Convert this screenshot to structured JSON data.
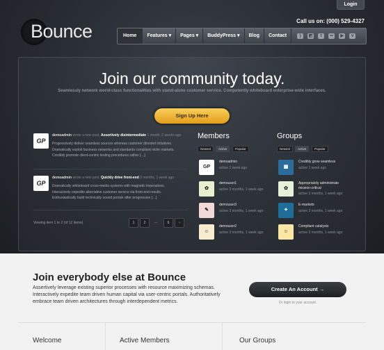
{
  "header": {
    "login_label": "Login",
    "phone": "Call us on: (000) 529-4327",
    "logo": "Bounce",
    "nav": [
      {
        "label": "Home"
      },
      {
        "label": "Features ▾"
      },
      {
        "label": "Pages ▾"
      },
      {
        "label": "BuddyPress ▾"
      },
      {
        "label": "Blog"
      },
      {
        "label": "Contact"
      }
    ],
    "social_icons": [
      "rss-icon",
      "delicious-icon",
      "twitter-icon",
      "flickr-icon",
      "youtube-icon",
      "vimeo-icon"
    ]
  },
  "hero": {
    "title": "Join our community today.",
    "subtitle": "Seamlessly network world-class functionalities with stand-alone customer service. Competently whiteboard enterprise-wide interfaces.",
    "signup_label": "Sign Up Here"
  },
  "activity": {
    "items": [
      {
        "avatar": "GP",
        "user": "demoadmin",
        "action": "wrote a new post,",
        "link": "Assertively disintermediate",
        "time": "1 month, 2 weeks ago",
        "lines": [
          "Progressively deliver seamless sources whereas customer directed initiatives.",
          "Dramatically exploit business networks and standards compliant niche markets.",
          "Credibly promote client-centric testing procedures rather […]"
        ]
      },
      {
        "avatar": "GP",
        "user": "demoadmin",
        "action": "wrote a new post,",
        "link": "Quickly drive front-end",
        "time": "3 months, 1 week ago",
        "lines": [
          "Dramatically whiteboard cross-media systems with magnetic imperatives.",
          "Interactively expedite alternative customer service via front-end results.",
          "Enthusiastically build technically sound portals after progressive […]"
        ]
      }
    ],
    "viewing": "Viewing item 1 to 2 (of 12 items)",
    "pages": [
      "1",
      "2",
      "…",
      "6",
      "›"
    ]
  },
  "members": {
    "title": "Members",
    "tabs": [
      "Newest",
      "Active",
      "Popular"
    ],
    "items": [
      {
        "name": "demoadmin",
        "time": "active 1 week ago",
        "avatar": "GP"
      },
      {
        "name": "demouser1",
        "time": "active 3 months, 1 week ago",
        "avatar": "✿"
      },
      {
        "name": "demouser3",
        "time": "active 3 months, 1 week ago",
        "avatar": "✎"
      },
      {
        "name": "demouser2",
        "time": "active 3 months, 1 week ago",
        "avatar": "☺"
      }
    ]
  },
  "groups": {
    "title": "Groups",
    "tabs": [
      "Newest",
      "Active",
      "Popular"
    ],
    "items": [
      {
        "name": "Credibly grow seamless",
        "time": "active 1 week ago",
        "avatar": "▦"
      },
      {
        "name": "Appropriately administrate mission-critical",
        "time": "active 3 months, 1 week ago",
        "avatar": "✿"
      },
      {
        "name": "E-markets",
        "time": "active 3 months, 1 week ago",
        "avatar": "✦"
      },
      {
        "name": "Compliant catalysts",
        "time": "active 3 months, 1 week ago",
        "avatar": "☺"
      }
    ]
  },
  "join": {
    "title": "Join everybody else at Bounce",
    "text": "Assertively leverage existing superior processes with resource maximizing schemas. Interactively expedite team driven human capital via user-centric portals. Authoritatively embrace team driven architectures through interdependent metrics.",
    "create_label": "Create An Account →",
    "login_text": "Or login to your account."
  },
  "footer": {
    "cols": [
      "Welcome",
      "Active Members",
      "Our Groups"
    ]
  }
}
